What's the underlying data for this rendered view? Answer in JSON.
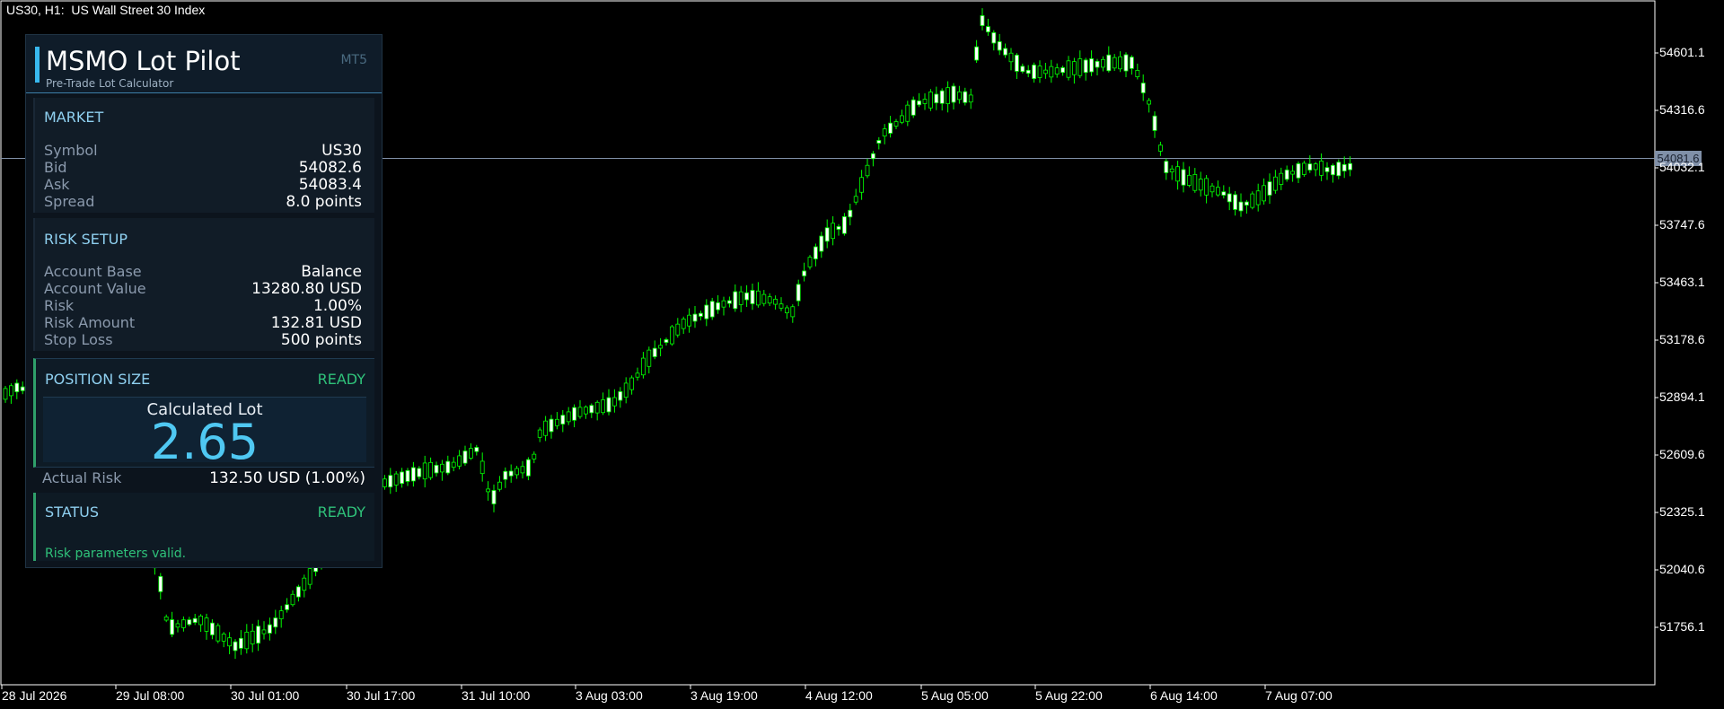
{
  "chart": {
    "title": "US30, H1:  US Wall Street 30 Index",
    "current_price": "54081.6",
    "price_labels": [
      "54601.1",
      "54316.6",
      "54032.1",
      "53747.6",
      "53463.1",
      "53178.6",
      "52894.1",
      "52609.6",
      "52325.1",
      "52040.6",
      "51756.1"
    ],
    "time_labels": [
      "28 Jul 2026",
      "29 Jul 08:00",
      "30 Jul 01:00",
      "30 Jul 17:00",
      "31 Jul 10:00",
      "3 Aug 03:00",
      "3 Aug 19:00",
      "4 Aug 12:00",
      "5 Aug 05:00",
      "5 Aug 22:00",
      "6 Aug 14:00",
      "7 Aug 07:00"
    ],
    "colors": {
      "bull": "#00ff00",
      "bear": "#00ff00",
      "bull_body": "#00ff00",
      "bear_body": "#ffffff",
      "price_line": "#8090a8",
      "tag_bg": "#8090a8"
    }
  },
  "panel": {
    "title": "MSMO Lot Pilot",
    "subtitle": "Pre-Trade Lot Calculator",
    "tag": "MT5",
    "market": {
      "title": "MARKET",
      "rows": [
        {
          "label": "Symbol",
          "value": "US30"
        },
        {
          "label": "Bid",
          "value": "54082.6"
        },
        {
          "label": "Ask",
          "value": "54083.4"
        },
        {
          "label": "Spread",
          "value": "8.0 points"
        }
      ]
    },
    "risk": {
      "title": "RISK SETUP",
      "rows": [
        {
          "label": "Account Base",
          "value": "Balance"
        },
        {
          "label": "Account Value",
          "value": "13280.80 USD"
        },
        {
          "label": "Risk",
          "value": "1.00%"
        },
        {
          "label": "Risk Amount",
          "value": "132.81 USD"
        },
        {
          "label": "Stop Loss",
          "value": "500 points"
        }
      ]
    },
    "position": {
      "title": "POSITION SIZE",
      "status": "READY",
      "calc_label": "Calculated Lot",
      "calc_value": "2.65",
      "actual_label": "Actual Risk",
      "actual_value": "132.50 USD (1.00%)"
    },
    "status": {
      "title": "STATUS",
      "status": "READY",
      "message": "Risk parameters valid."
    }
  }
}
